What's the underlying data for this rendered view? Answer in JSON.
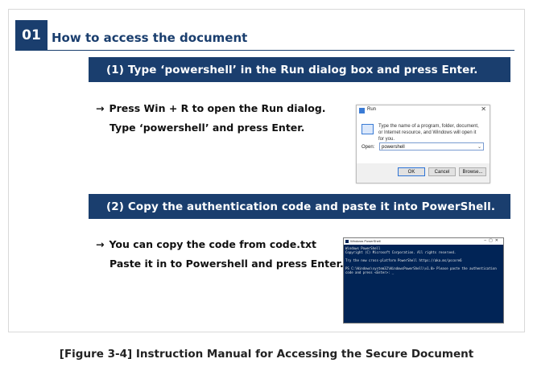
{
  "section": {
    "number": "01",
    "title": "How to access the document"
  },
  "steps": [
    {
      "band": "(1) Type ‘powershell’ in the Run dialog box and press Enter.",
      "arrow": "→",
      "line1": "Press Win + R to open the Run dialog.",
      "line2": "Type ‘powershell’ and press Enter."
    },
    {
      "band": "(2) Copy the authentication code and paste it into PowerShell.",
      "arrow": "→",
      "line1": "You can copy the code from code.txt",
      "line2": "Paste it in to Powershell and press Enter."
    }
  ],
  "run_dialog": {
    "title": "Run",
    "close": "✕",
    "description": "Type the name of a program, folder, document, or Internet resource, and Windows will open it for you.",
    "open_label": "Open:",
    "open_value": "powershell",
    "ok": "OK",
    "cancel": "Cancel",
    "browse": "Browse..."
  },
  "powershell": {
    "title": "Windows PowerShell",
    "controls": "–▢✕",
    "lines": "Windows PowerShell\nCopyright (C) Microsoft Corporation. All rights reserved.\n\nTry the new cross-platform PowerShell https://aka.ms/pscore6\n\nPS C:\\Windows\\system32\\WindowsPowerShell\\v1.0> Please paste the authentication code and press <Enter>: _"
  },
  "caption": "[Figure 3-4] Instruction Manual for Accessing the Secure Document",
  "colors": {
    "accent": "#1a3e6e",
    "powershell_bg": "#012456"
  }
}
